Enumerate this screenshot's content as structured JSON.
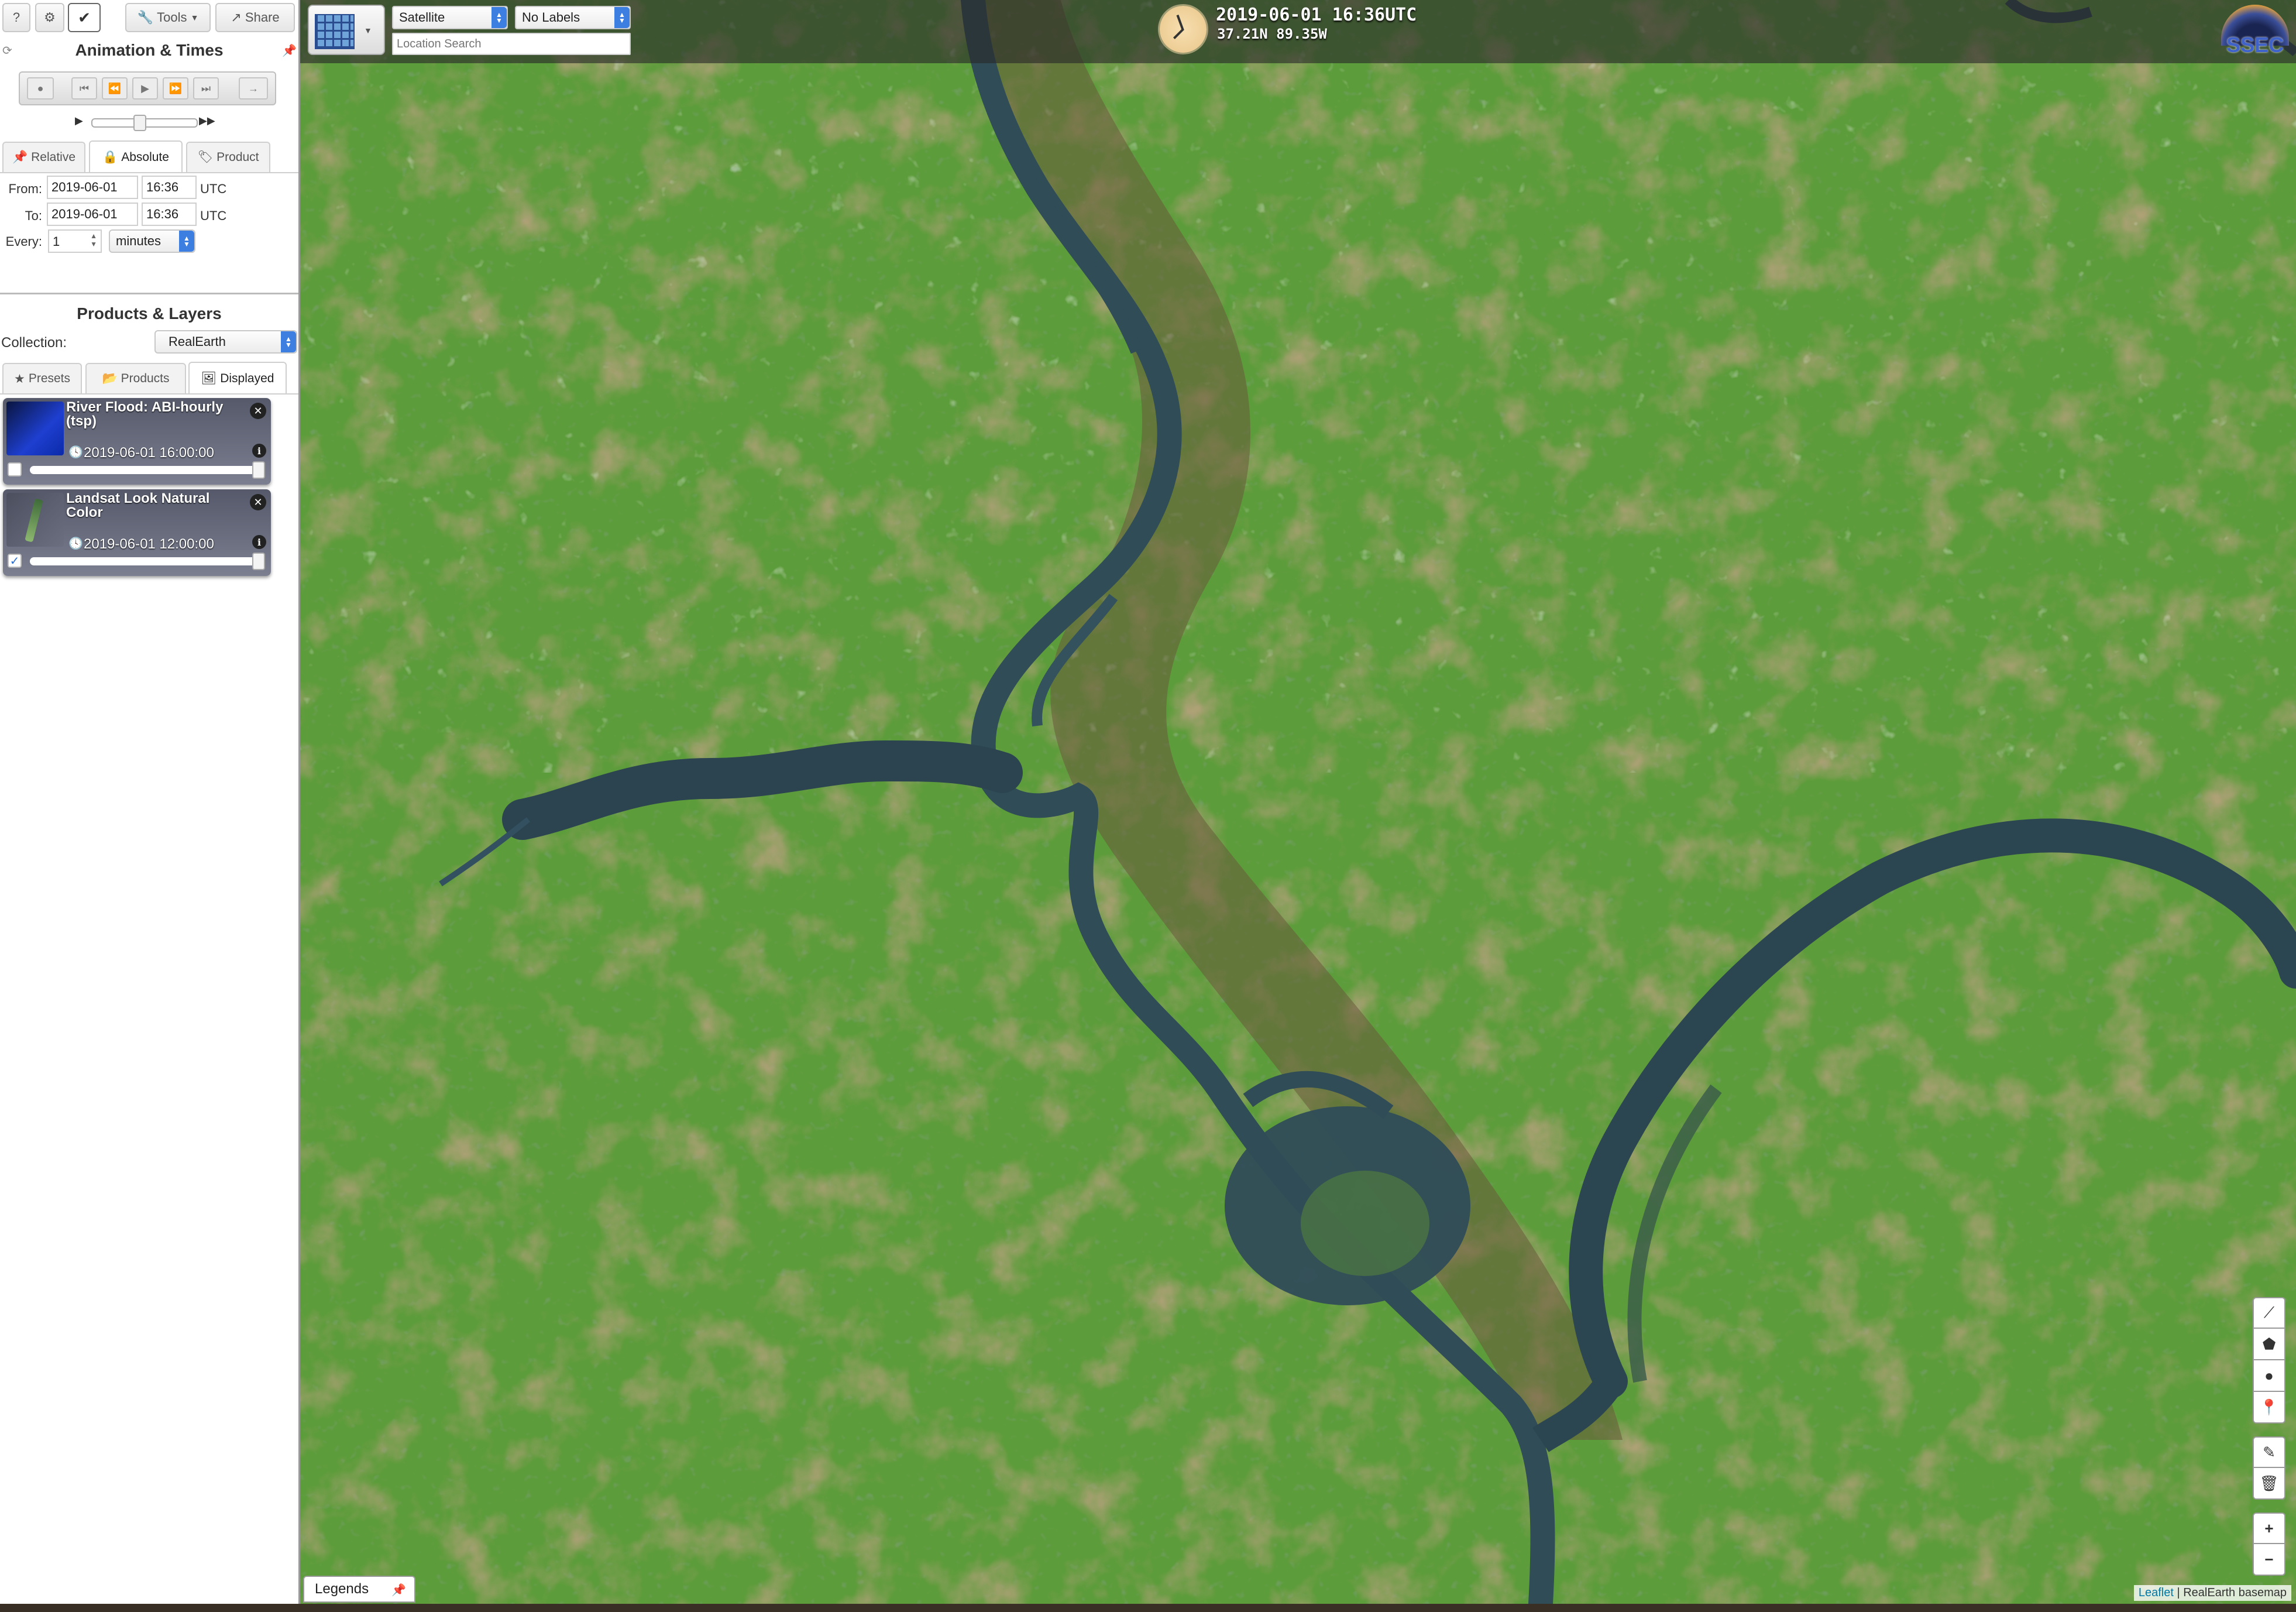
{
  "toolbar": {
    "help_label": "?",
    "tools_label": "Tools",
    "share_label": "Share"
  },
  "animation": {
    "title": "Animation & Times",
    "tabs": [
      {
        "label": "Relative"
      },
      {
        "label": "Absolute"
      },
      {
        "label": "Product"
      }
    ],
    "active_tab": "Absolute",
    "from_label": "From:",
    "from_date": "2019-06-01",
    "from_time": "16:36",
    "from_tz": "UTC",
    "to_label": "To:",
    "to_date": "2019-06-01",
    "to_time": "16:36",
    "to_tz": "UTC",
    "every_label": "Every:",
    "every_value": "1",
    "every_unit": "minutes"
  },
  "products": {
    "title": "Products & Layers",
    "collection_label": "Collection:",
    "collection_value": "RealEarth",
    "tabs": [
      {
        "label": "Presets"
      },
      {
        "label": "Products"
      },
      {
        "label": "Displayed"
      }
    ],
    "active_tab": "Displayed",
    "layers": [
      {
        "title": "River Flood: ABI-hourly (tsp)",
        "time": "2019-06-01 16:00:00",
        "checked": false
      },
      {
        "title": "Landsat Look Natural Color",
        "time": "2019-06-01 12:00:00",
        "checked": true
      }
    ]
  },
  "map": {
    "basemap_select": "Satellite",
    "labels_select": "No Labels",
    "search_placeholder": "Location Search",
    "datetime": "2019-06-01 16:36UTC",
    "coords": "37.21N 89.35W",
    "logo_text": "SSEC",
    "legends_label": "Legends",
    "attribution_link": "Leaflet",
    "attribution_text": " | RealEarth basemap",
    "zoom_in": "+",
    "zoom_out": "−",
    "colors": {
      "land": "#5c9a3a",
      "water": "#2e4a55",
      "bar": "#3a3a3a"
    }
  }
}
